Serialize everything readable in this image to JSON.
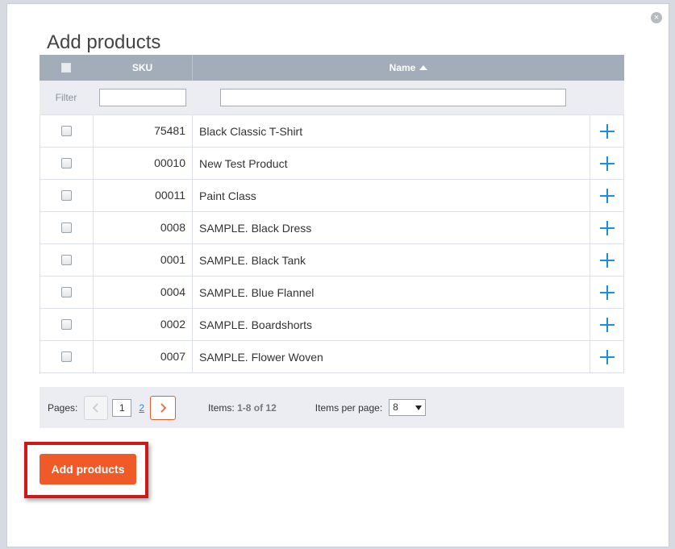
{
  "dialog": {
    "title": "Add products",
    "close_icon": "close-icon",
    "close_glyph": "×"
  },
  "table": {
    "columns": {
      "sku": "SKU",
      "name": "Name"
    },
    "sort": {
      "column": "name",
      "direction": "ascending"
    },
    "filter": {
      "label": "Filter",
      "sku_value": "",
      "name_value": ""
    },
    "rows": [
      {
        "sku": "75481",
        "name": "Black Classic T-Shirt"
      },
      {
        "sku": "00010",
        "name": "New Test Product"
      },
      {
        "sku": "00011",
        "name": "Paint Class"
      },
      {
        "sku": "0008",
        "name": "SAMPLE. Black Dress"
      },
      {
        "sku": "0001",
        "name": "SAMPLE. Black Tank"
      },
      {
        "sku": "0004",
        "name": "SAMPLE. Blue Flannel"
      },
      {
        "sku": "0002",
        "name": "SAMPLE. Boardshorts"
      },
      {
        "sku": "0007",
        "name": "SAMPLE. Flower Woven"
      }
    ]
  },
  "pagination": {
    "label": "Pages:",
    "current_page": "1",
    "next_page": "2",
    "items_label": "Items:",
    "items_range": "1-8",
    "items_of": "of",
    "items_total": "12",
    "per_page_label": "Items per page:",
    "per_page_value": "8"
  },
  "actions": {
    "add_products_label": "Add products"
  },
  "colors": {
    "accent": "#f05a28",
    "link": "#1a8fe0",
    "header_bg": "#a3adb9",
    "highlight_border": "#cc1a1a"
  }
}
